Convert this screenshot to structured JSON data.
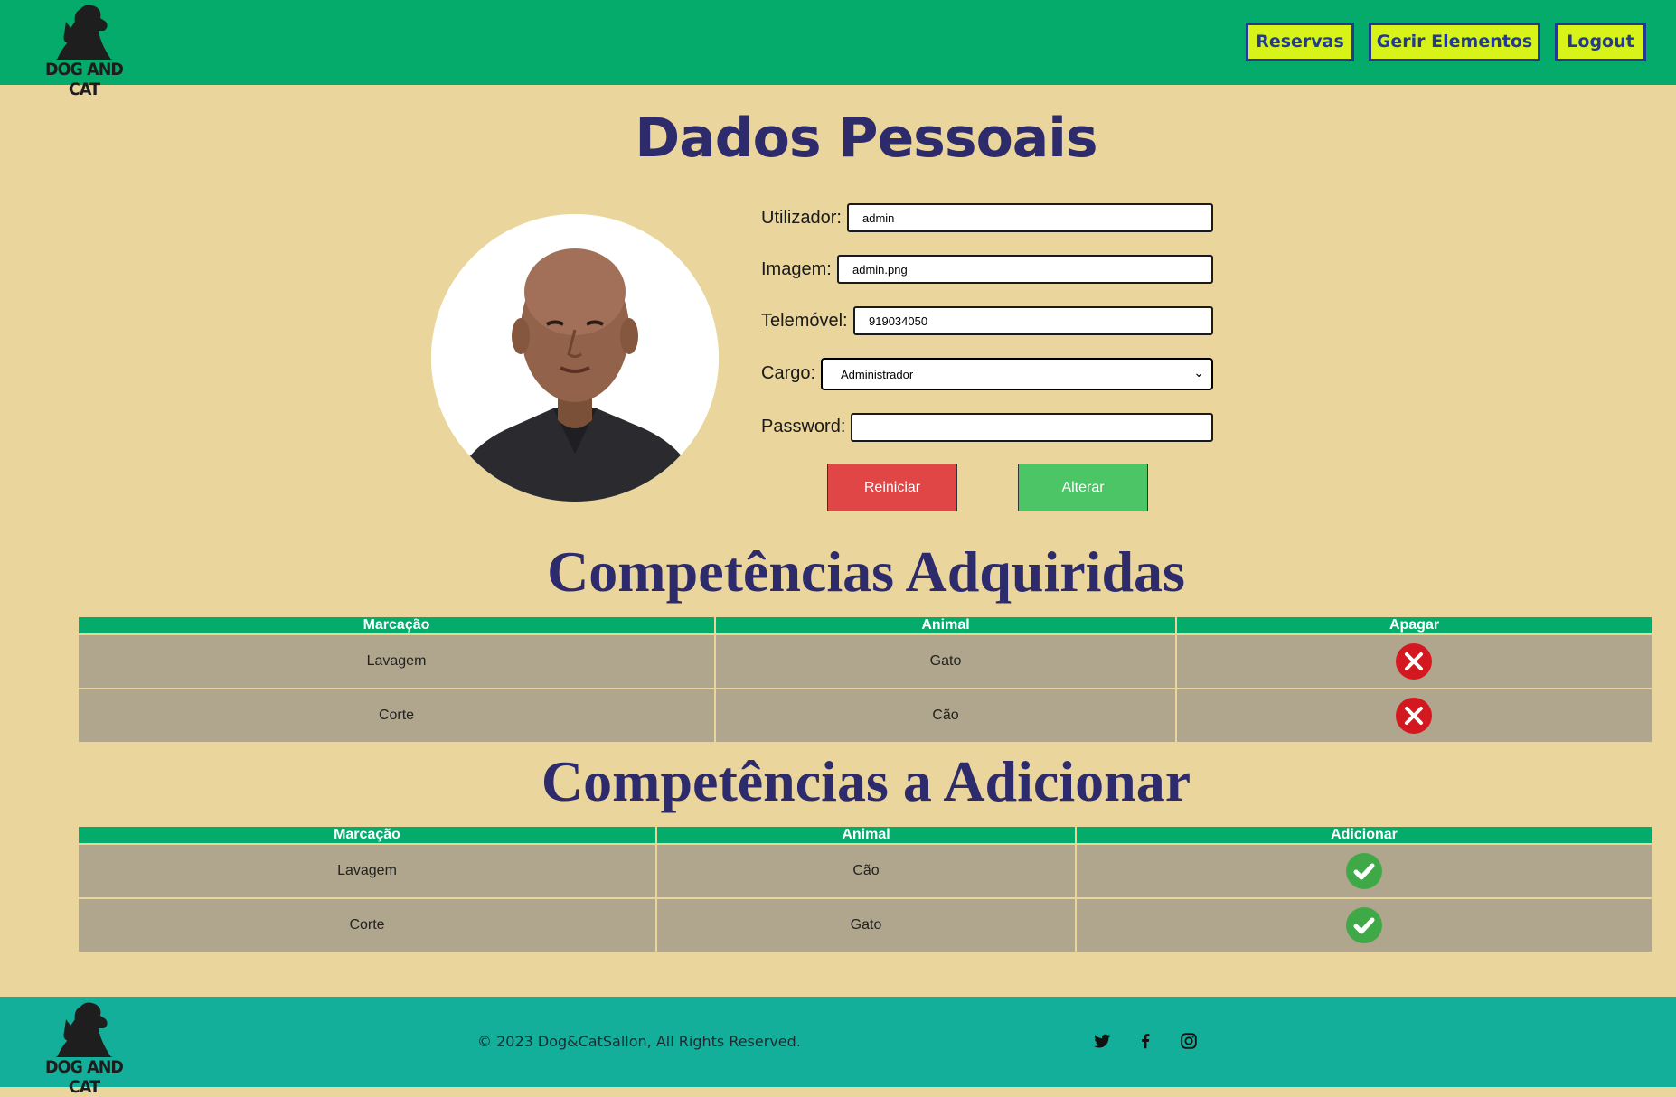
{
  "header": {
    "logo_text": "DOG AND CAT",
    "nav": {
      "reservas": "Reservas",
      "gerir": "Gerir Elementos",
      "logout": "Logout"
    }
  },
  "profile": {
    "title": "Dados Pessoais",
    "fields": {
      "utilizador_label": "Utilizador:",
      "utilizador_value": "admin",
      "imagem_label": "Imagem:",
      "imagem_value": "admin.png",
      "telemovel_label": "Telemóvel:",
      "telemovel_value": "919034050",
      "cargo_label": "Cargo:",
      "cargo_value": "Administrador",
      "password_label": "Password:",
      "password_value": ""
    },
    "buttons": {
      "reset": "Reiniciar",
      "submit": "Alterar"
    }
  },
  "acquired": {
    "title": "Competências Adquiridas",
    "columns": [
      "Marcação",
      "Animal",
      "Apagar"
    ],
    "rows": [
      {
        "marcacao": "Lavagem",
        "animal": "Gato"
      },
      {
        "marcacao": "Corte",
        "animal": "Cão"
      }
    ]
  },
  "to_add": {
    "title": "Competências a Adicionar",
    "columns": [
      "Marcação",
      "Animal",
      "Adicionar"
    ],
    "rows": [
      {
        "marcacao": "Lavagem",
        "animal": "Cão"
      },
      {
        "marcacao": "Corte",
        "animal": "Gato"
      }
    ]
  },
  "footer": {
    "logo_text": "DOG AND CAT",
    "copyright": "© 2023 Dog&CatSallon, All Rights Reserved.",
    "social": [
      "twitter-icon",
      "facebook-icon",
      "instagram-icon"
    ]
  },
  "colors": {
    "header_bg": "#05ab6b",
    "page_bg": "#ead59d",
    "nav_button": "#d8f319",
    "nav_border": "#223a8f",
    "title": "#2d2b6b",
    "reset_button": "#e04646",
    "submit_button": "#4bc566",
    "table_header": "#05ab6b",
    "table_cell": "#afa68d",
    "footer_bg": "#13af9a"
  }
}
